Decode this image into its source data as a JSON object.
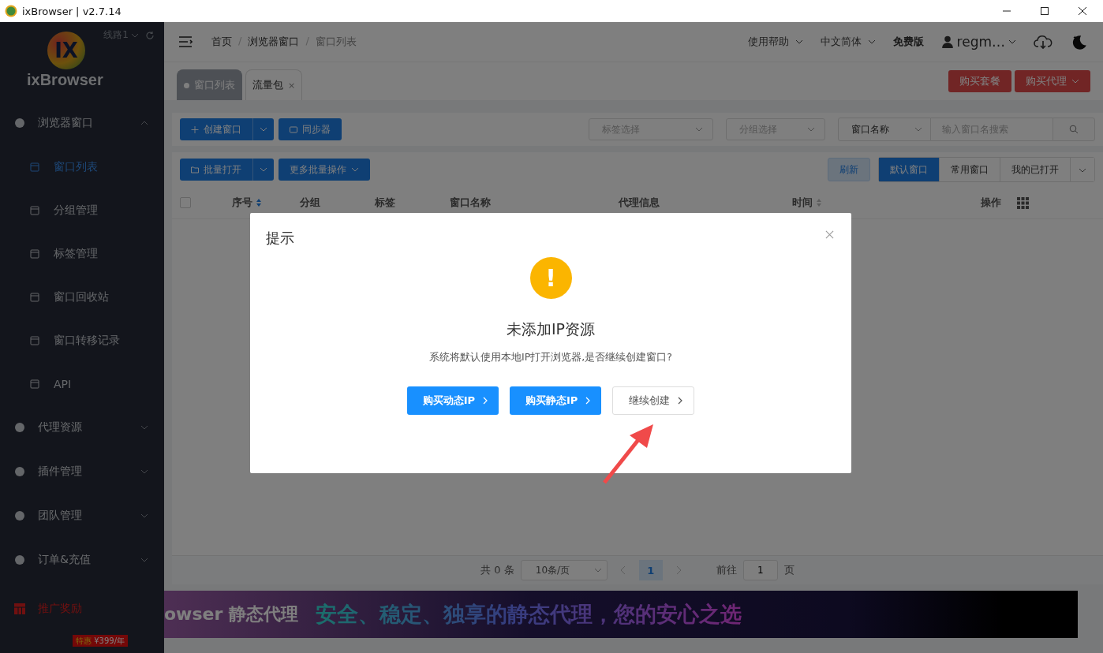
{
  "window": {
    "title": "ixBrowser | v2.7.14"
  },
  "sidebar": {
    "logo_mark": "IX",
    "brand": "ixBrowser",
    "route": "线路1",
    "items": [
      {
        "label": "浏览器窗口",
        "kind": "group",
        "expanded": true,
        "children": [
          {
            "label": "窗口列表",
            "selected": true
          },
          {
            "label": "分组管理",
            "selected": false
          },
          {
            "label": "标签管理",
            "selected": false
          },
          {
            "label": "窗口回收站",
            "selected": false
          },
          {
            "label": "窗口转移记录",
            "selected": false
          },
          {
            "label": "API",
            "selected": false
          }
        ]
      },
      {
        "label": "代理资源",
        "kind": "group",
        "expanded": false
      },
      {
        "label": "插件管理",
        "kind": "group",
        "expanded": false
      },
      {
        "label": "团队管理",
        "kind": "group",
        "expanded": false
      },
      {
        "label": "订单&充值",
        "kind": "group",
        "expanded": false
      },
      {
        "label": "推广奖励",
        "kind": "promo"
      }
    ],
    "badge": {
      "tag": "特惠",
      "price": "¥399/年"
    }
  },
  "header": {
    "breadcrumb": [
      "首页",
      "浏览器窗口",
      "窗口列表"
    ],
    "separator": "/",
    "help": "使用帮助",
    "language": "中文简体",
    "plan": "免费版",
    "user": "regm…"
  },
  "tabs": [
    {
      "label": "窗口列表",
      "selected": true,
      "closable": false
    },
    {
      "label": "流量包",
      "selected": false,
      "closable": true
    }
  ],
  "close_glyph": "×",
  "top_buttons": [
    "购买套餐",
    "购买代理"
  ],
  "toolbar": {
    "create": "创建窗口",
    "sync": "同步器",
    "tag_select": "标签选择",
    "group_select": "分组选择",
    "search_field": "窗口名称",
    "search_placeholder": "输入窗口名搜索"
  },
  "actions": {
    "batch_open": "批量打开",
    "more": "更多批量操作",
    "refresh": "刷新",
    "views": [
      {
        "label": "默认窗口",
        "selected": true
      },
      {
        "label": "常用窗口",
        "selected": false
      },
      {
        "label": "我的已打开",
        "selected": false
      }
    ]
  },
  "table": {
    "select_all_checked": false,
    "columns": [
      {
        "label": "序号",
        "sortable": true
      },
      {
        "label": "分组",
        "sortable": false
      },
      {
        "label": "标签",
        "sortable": false
      },
      {
        "label": "窗口名称",
        "sortable": false
      },
      {
        "label": "代理信息",
        "sortable": false
      },
      {
        "label": "时间",
        "sortable": true
      },
      {
        "label": "操作",
        "sortable": false
      }
    ]
  },
  "pagination": {
    "total": "共 0 条",
    "page_size": "10条/页",
    "pages": [
      {
        "label": "1",
        "selected": true
      }
    ],
    "goto": "前往",
    "goto_value": "1",
    "page_unit": "页"
  },
  "banner": {
    "lead": "owser 静态代理",
    "slogan": "安全、稳定、独享的静态代理，您的安心之选"
  },
  "dialog": {
    "title": "提示",
    "icon_glyph": "!",
    "heading": "未添加IP资源",
    "message": "系统将默认使用本地IP打开浏览器,是否继续创建窗口?",
    "buttons": [
      {
        "label": "购买动态IP",
        "kind": "primary"
      },
      {
        "label": "购买静态IP",
        "kind": "primary"
      },
      {
        "label": "继续创建",
        "kind": "default"
      }
    ]
  }
}
